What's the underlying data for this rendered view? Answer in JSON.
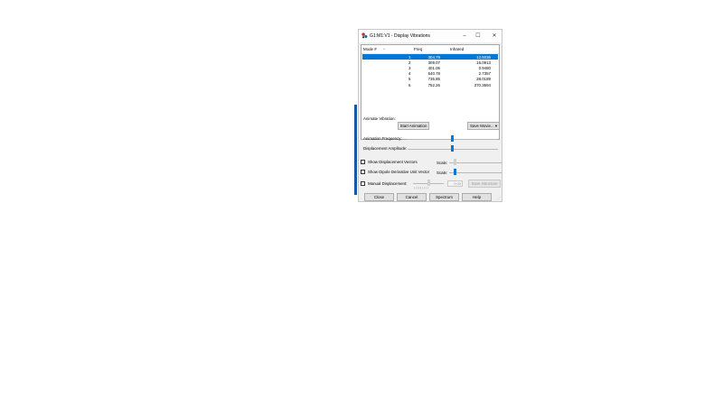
{
  "window": {
    "title": "G1:M1:V1 - Display Vibrations",
    "minimize": "–",
    "maximize": "☐",
    "close": "✕"
  },
  "table": {
    "headers": [
      "Mode #",
      "Freq",
      "Infrared"
    ],
    "sort_indicator": "^",
    "selected_index": 0,
    "rows": [
      {
        "mode": "1",
        "freq": "304.79",
        "ir": "12.5036"
      },
      {
        "mode": "2",
        "freq": "309.07",
        "ir": "16.0913"
      },
      {
        "mode": "3",
        "freq": "401.06",
        "ir": "0.9480"
      },
      {
        "mode": "4",
        "freq": "540.78",
        "ir": "2.7357"
      },
      {
        "mode": "5",
        "freq": "735.85",
        "ir": "38.0189"
      },
      {
        "mode": "6",
        "freq": "752.26",
        "ir": "370.3594"
      }
    ]
  },
  "animate": {
    "label": "Animate Vibration:",
    "start_button": "Start Animation",
    "save_movie_button": "Save Movie...",
    "frequency_label": "Animation Frequency:",
    "amplitude_label": "Displacement Amplitude:"
  },
  "vectors": {
    "displacement_label": "Show Displacement Vectors",
    "dipole_label": "Show Dipole Derivative Unit Vector",
    "scale_label_1": "Scale:",
    "scale_label_2": "Scale:"
  },
  "manual": {
    "label": "Manual Displacement:",
    "value": "0.00",
    "save_structure_button": "Save Structure"
  },
  "footer": {
    "close": "Close",
    "cancel": "Cancel",
    "spectrum": "Spectrum",
    "help": "Help"
  },
  "colors": {
    "selection": "#0078d7",
    "accent_bar": "#1a56a8"
  }
}
